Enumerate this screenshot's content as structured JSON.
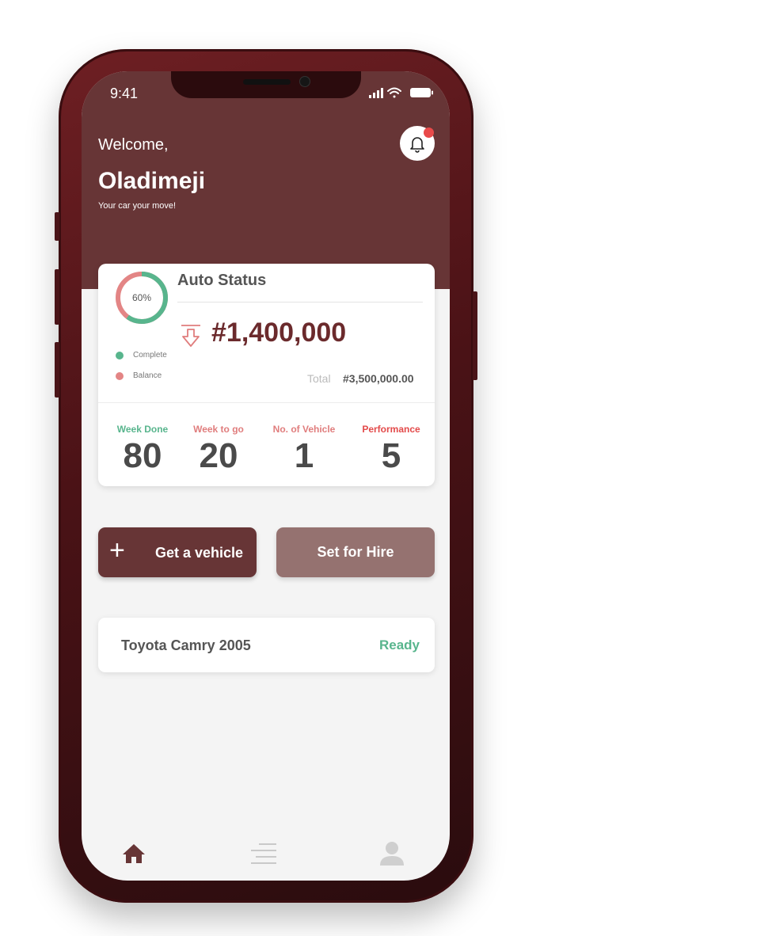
{
  "statusbar": {
    "time": "9:41"
  },
  "header": {
    "welcome": "Welcome,",
    "name": "Oladimeji",
    "tagline": "Your car your move!"
  },
  "auto_status": {
    "title": "Auto Status",
    "progress_label": "60%",
    "progress_fraction": 0.6,
    "legend": [
      {
        "label": "Complete",
        "color": "#58b58d"
      },
      {
        "label": "Balance",
        "color": "#e38585"
      }
    ],
    "amount": "#1,400,000",
    "total_label": "Total",
    "total_value": "#3,500,000.00"
  },
  "stats": [
    {
      "label": "Week Done",
      "value": "80",
      "color": "#58b58d"
    },
    {
      "label": "Week to go",
      "value": "20",
      "color": "#e07d7d"
    },
    {
      "label": "No. of Vehicle",
      "value": "1",
      "color": "#e07d7d"
    },
    {
      "label": "Performance",
      "value": "5",
      "color": "#e34a4a"
    }
  ],
  "actions": {
    "get_vehicle": "Get a vehicle",
    "set_for_hire": "Set for Hire"
  },
  "vehicle": {
    "name": "Toyota Camry 2005",
    "status": "Ready"
  },
  "tabbar": [
    {
      "icon": "home-icon",
      "active": true
    },
    {
      "icon": "list-icon",
      "active": false
    },
    {
      "icon": "profile-icon",
      "active": false
    }
  ],
  "colors": {
    "primary": "#673536",
    "secondary": "#957270",
    "success": "#58b58d",
    "danger": "#e34a4a"
  }
}
